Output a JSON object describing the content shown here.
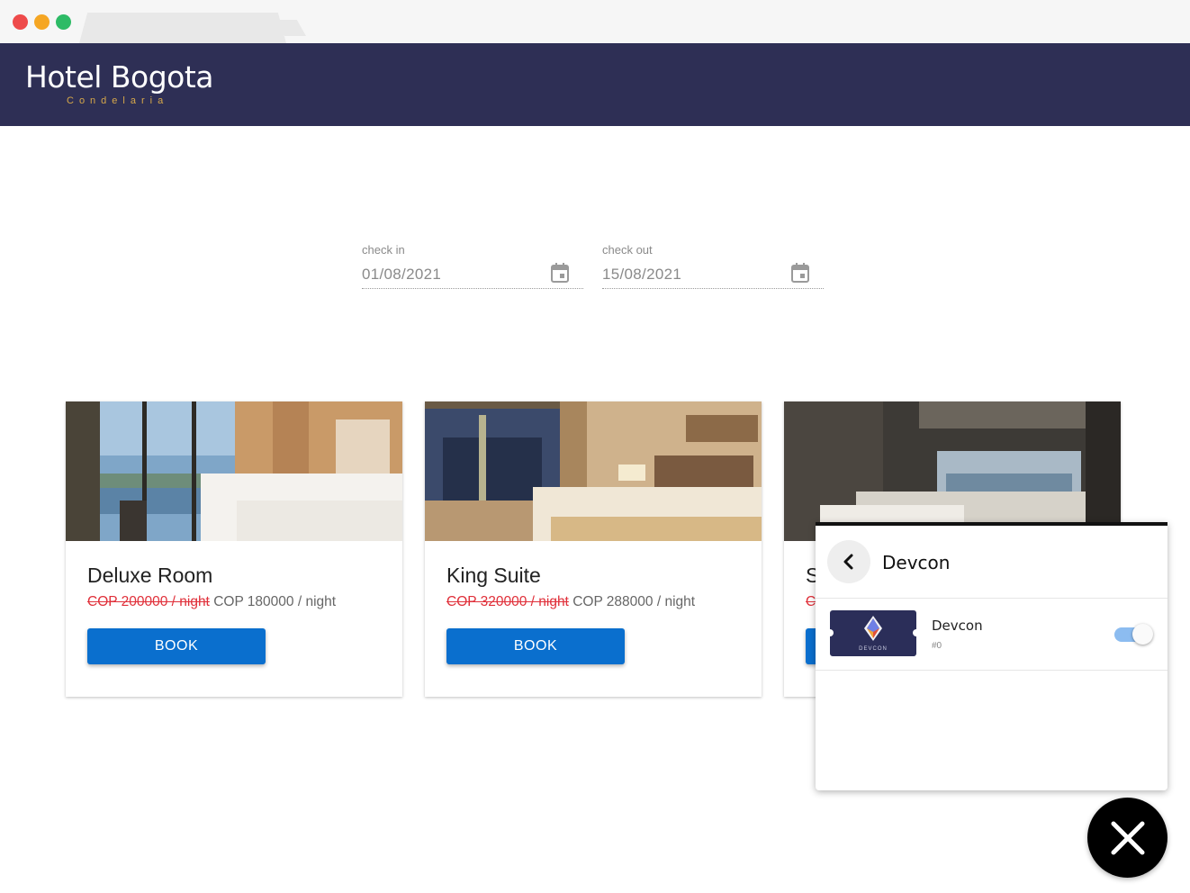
{
  "header": {
    "logo_title": "Hotel Bogota",
    "logo_subtitle": "Condelaria"
  },
  "booking": {
    "check_in_label": "check in",
    "check_in_value": "01/08/2021",
    "check_out_label": "check out",
    "check_out_value": "15/08/2021"
  },
  "rooms": [
    {
      "title": "Deluxe Room",
      "old_price": "COP 200000 / night",
      "price": "COP 180000 / night",
      "book_label": "BOOK"
    },
    {
      "title": "King Suite",
      "old_price": "COP 320000 / night",
      "price": "COP 288000 / night",
      "book_label": "BOOK"
    },
    {
      "title": "S",
      "old_price": "C",
      "price": "",
      "book_label": ""
    }
  ],
  "wallet_panel": {
    "title": "Devcon",
    "token": {
      "name": "Devcon",
      "id": "#0",
      "logo_text": "DEVCON",
      "enabled": true
    }
  },
  "colors": {
    "header_bg": "#2e2f55",
    "accent": "#d7a84a",
    "button": "#0a6fce",
    "strike": "#e0303a"
  },
  "icons": [
    "calendar-icon",
    "chevron-left-icon",
    "close-icon",
    "devcon-logo-icon"
  ]
}
